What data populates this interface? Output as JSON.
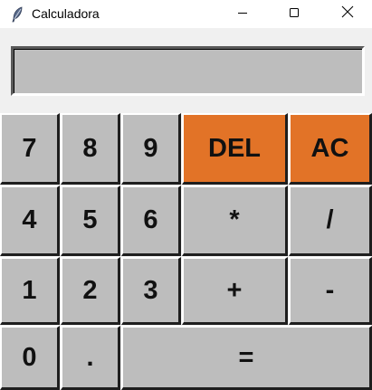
{
  "window": {
    "title": "Calculadora"
  },
  "display": {
    "value": ""
  },
  "keys": {
    "seven": "7",
    "eight": "8",
    "nine": "9",
    "del": "DEL",
    "ac": "AC",
    "four": "4",
    "five": "5",
    "six": "6",
    "multiply": "*",
    "divide": "/",
    "one": "1",
    "two": "2",
    "three": "3",
    "plus": "+",
    "minus": "-",
    "zero": "0",
    "dot": ".",
    "equals": "="
  },
  "colors": {
    "key": "#bdbdbd",
    "accent": "#e27327",
    "background": "#f0f0f0"
  },
  "icons": {
    "app": "feather-icon",
    "minimize": "minimize-icon",
    "maximize": "maximize-icon",
    "close": "close-icon"
  }
}
